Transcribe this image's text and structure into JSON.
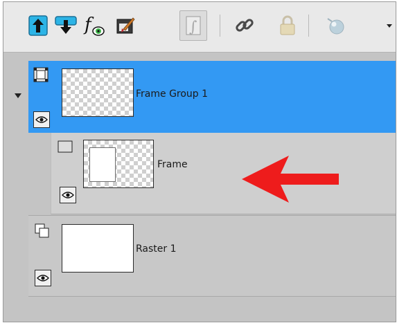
{
  "toolbar": {
    "buttons": [
      {
        "id": "move-up",
        "icon": "arrow-up-layer-icon"
      },
      {
        "id": "move-down",
        "icon": "arrow-down-layer-icon"
      },
      {
        "id": "layer-effects",
        "icon": "fx-eye-icon"
      },
      {
        "id": "edit-layer",
        "icon": "paint-brush-icon"
      },
      {
        "id": "script",
        "icon": "script-s-icon",
        "pressed": true
      },
      {
        "id": "link",
        "icon": "chain-link-icon"
      },
      {
        "id": "lock",
        "icon": "padlock-icon",
        "disabled": true
      },
      {
        "id": "mask",
        "icon": "sphere-mask-icon",
        "disabled": true
      }
    ],
    "more_icon": "dropdown-arrow-icon"
  },
  "layers": [
    {
      "name": "Frame Group 1",
      "type": "frame-group",
      "selected": true,
      "expanded": true,
      "visible": true
    },
    {
      "name": "Frame",
      "type": "frame",
      "selected": false,
      "visible": true,
      "child": true
    },
    {
      "name": "Raster 1",
      "type": "raster",
      "selected": false,
      "visible": true
    }
  ],
  "colors": {
    "selected_row": "#3399f3",
    "panel_bg": "#c4c4c4",
    "toolbar_bg": "#e9e9e9",
    "annotation_arrow": "#ee1c1c"
  }
}
